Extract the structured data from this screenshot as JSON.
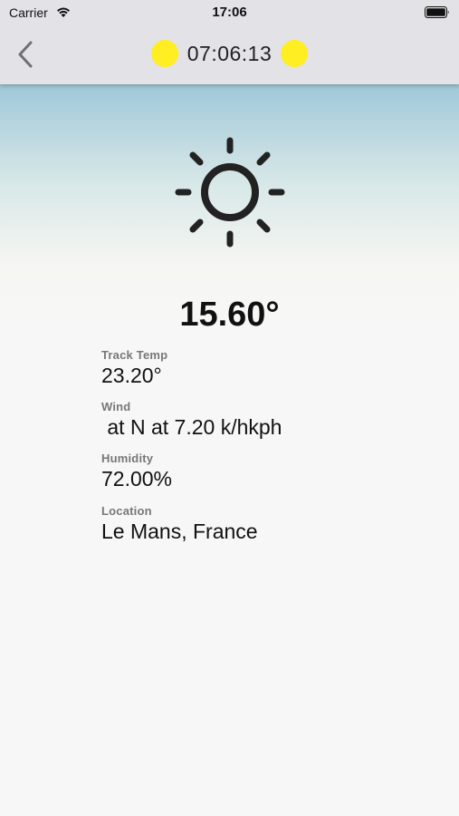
{
  "status_bar": {
    "carrier": "Carrier",
    "time": "17:06",
    "icons": [
      "wifi-icon",
      "battery-icon"
    ]
  },
  "nav": {
    "title": "07:06:13",
    "indicator_color": "#ffee22",
    "back_icon": "chevron-left-icon"
  },
  "weather": {
    "icon": "sun-icon",
    "air_temp": "15.60°",
    "fields": [
      {
        "label": "Track Temp",
        "value": "23.20°"
      },
      {
        "label": "Wind",
        "value": " at N at 7.20 k/hkph"
      },
      {
        "label": "Humidity",
        "value": "72.00%"
      },
      {
        "label": "Location",
        "value": "Le Mans, France"
      }
    ]
  }
}
